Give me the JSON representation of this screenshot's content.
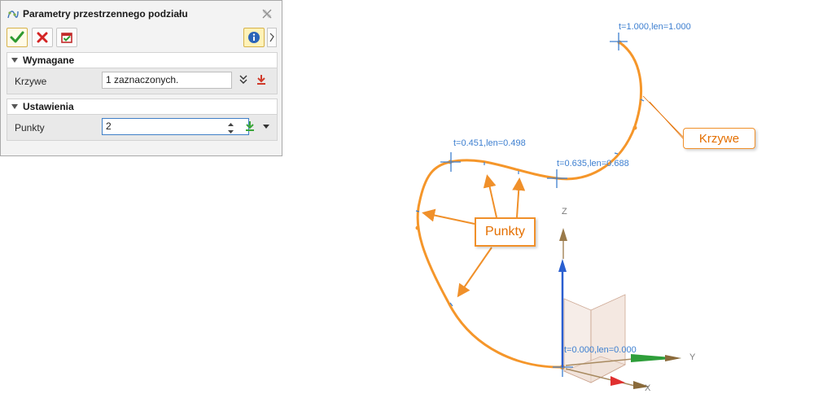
{
  "dialog": {
    "title": "Parametry przestrzennego podziału",
    "toolbar": {
      "ok_icon": "check-icon",
      "cancel_icon": "x-icon",
      "apply_icon": "apply-icon",
      "info_icon": "info-icon"
    },
    "sections": {
      "required": {
        "title": "Wymagane",
        "curves_label": "Krzywe",
        "curves_value": "1 zaznaczonych."
      },
      "settings": {
        "title": "Ustawienia",
        "points_label": "Punkty",
        "points_value": "2"
      }
    }
  },
  "viewport": {
    "point_labels": {
      "end": "t=1.000,len=1.000",
      "p1": "t=0.451,len=0.498",
      "p2": "t=0.635,len=0.688",
      "start": "t=0.000,len=0.000"
    },
    "callouts": {
      "curves": "Krzywe",
      "points": "Punkty"
    },
    "axes": {
      "x": "X",
      "y": "Y",
      "z": "Z"
    },
    "colors": {
      "curve": "#f5962a",
      "annotation": "#e46f00",
      "point_label": "#3d7fd0",
      "axis_z": "#2a5fd0",
      "axis_x": "#e03030",
      "axis_y": "#2e9e3a"
    }
  }
}
